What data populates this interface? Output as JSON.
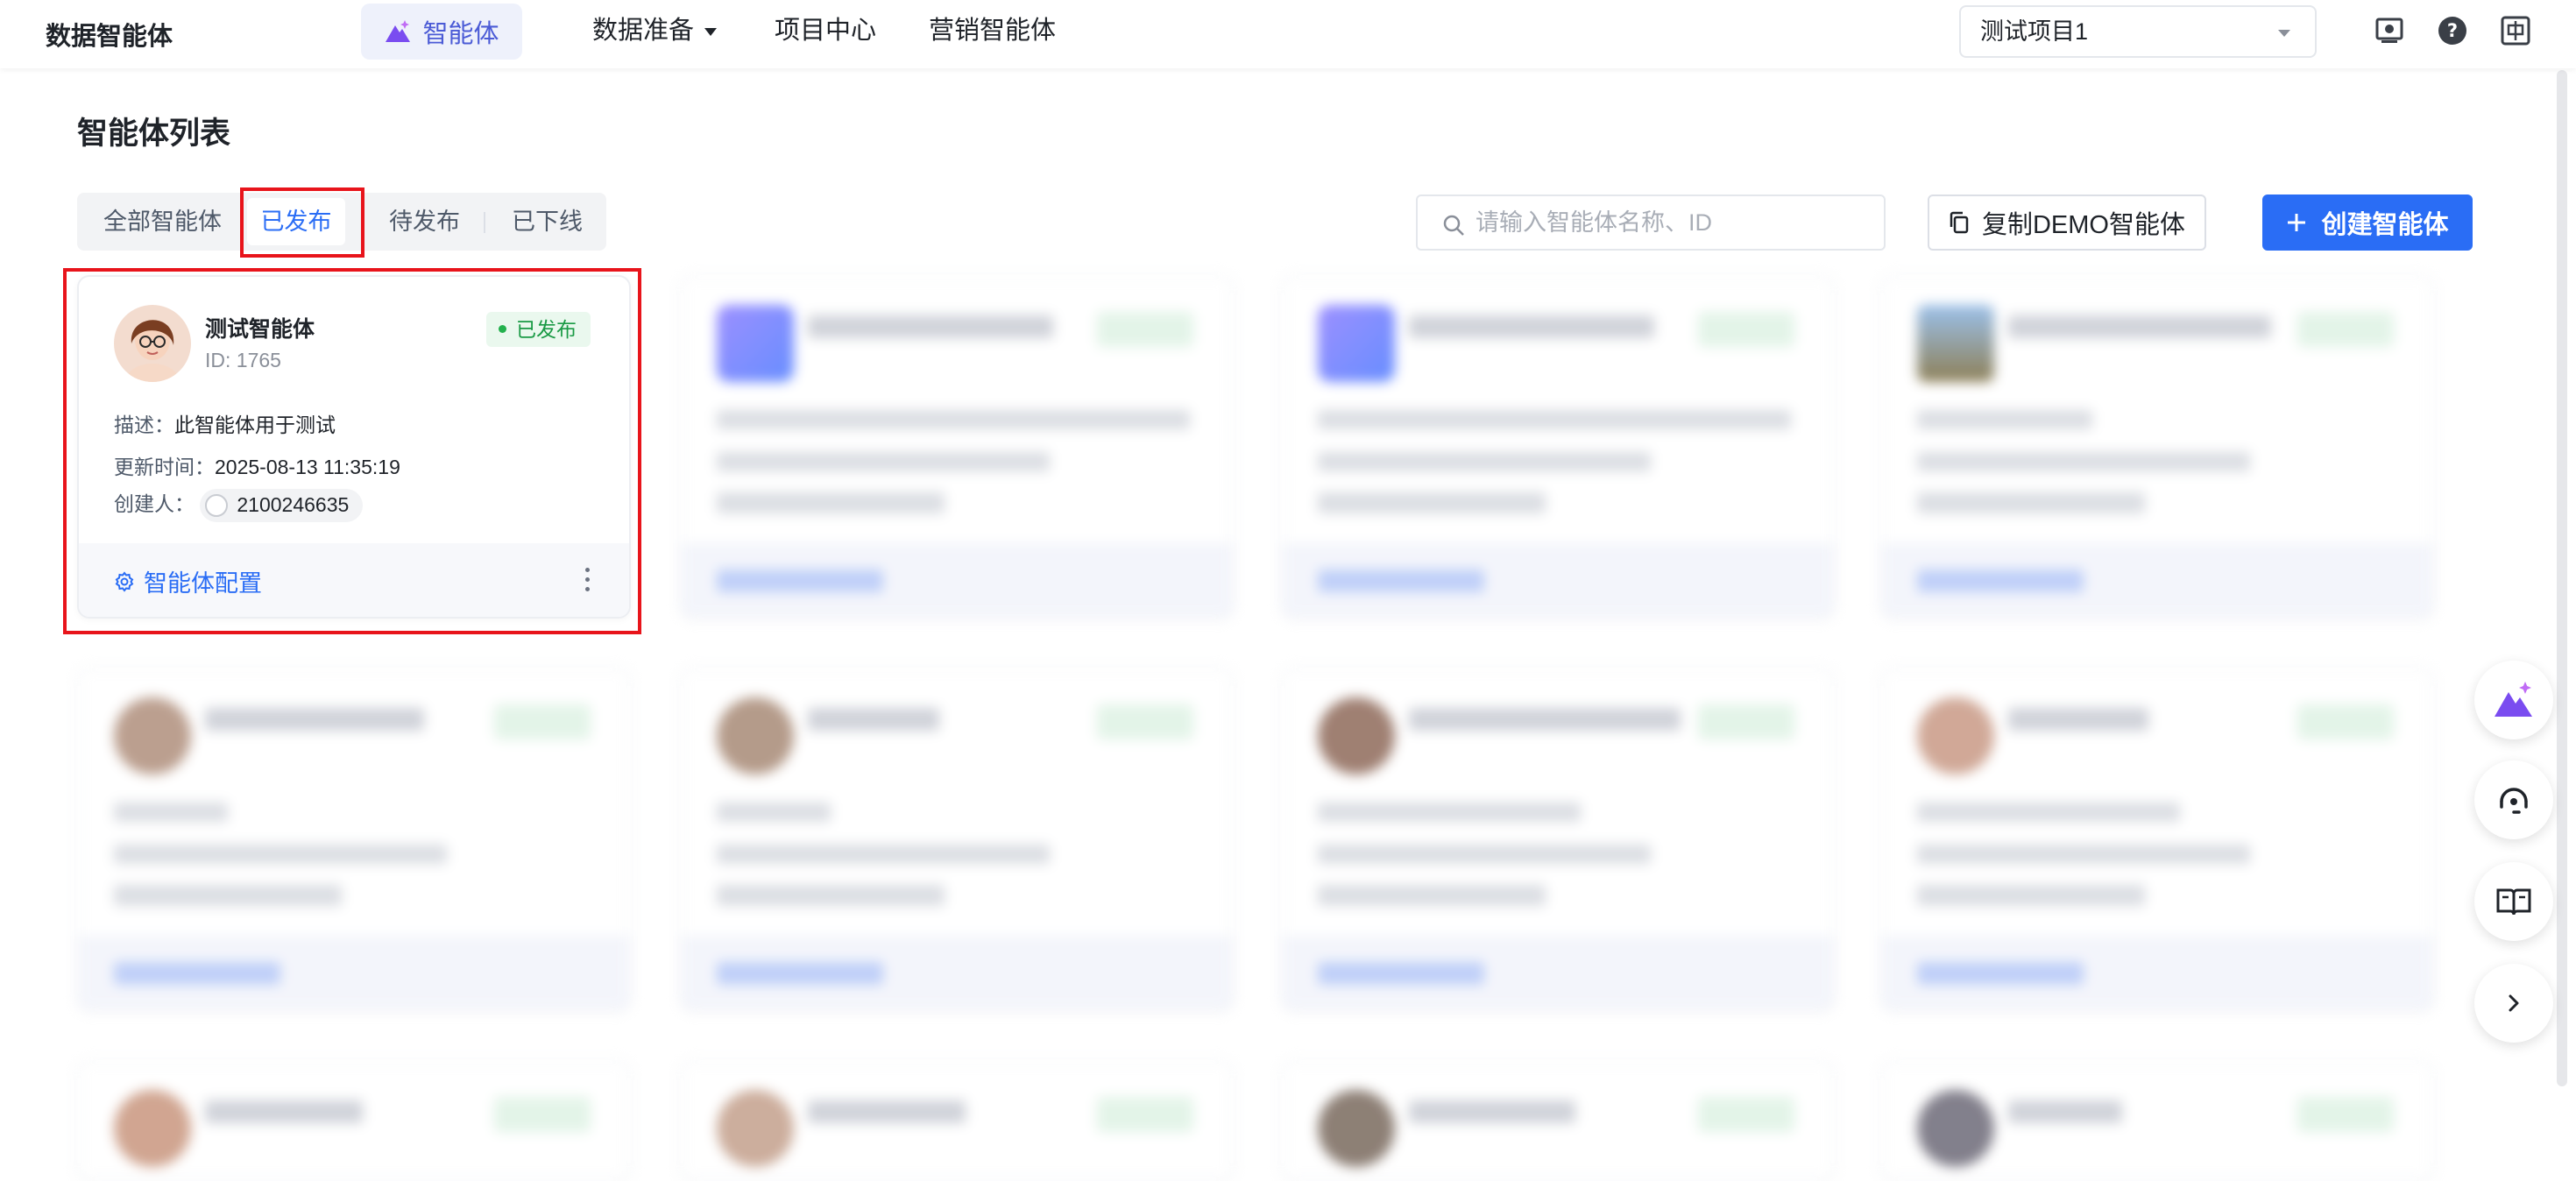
{
  "nav": {
    "brand": "数据智能体",
    "active": "智能体",
    "items": [
      "数据准备",
      "项目中心",
      "营销智能体"
    ],
    "project_select": "测试项目1"
  },
  "page": {
    "title": "智能体列表",
    "tabs": [
      "全部智能体",
      "已发布",
      "待发布",
      "已下线"
    ],
    "active_tab": "已发布",
    "search_placeholder": "请输入智能体名称、ID",
    "copy_button": "复制DEMO智能体",
    "create_button": "创建智能体"
  },
  "featured_card": {
    "name": "测试智能体",
    "id": "ID: 1765",
    "status": "已发布",
    "desc_label": "描述：",
    "desc_value": "此智能体用于测试",
    "updated_label": "更新时间：",
    "updated_value": "2025-08-13 11:35:19",
    "creator_label": "创建人：",
    "creator_value": "2100246635",
    "config_label": "智能体配置"
  },
  "colors": {
    "accent": "#2a6df5",
    "status_green": "#1a9a45",
    "highlight_red": "#e8141b",
    "brand_purple": "#7a4cf0"
  },
  "icons": {
    "nav_logo": "sparkle-mountain-icon",
    "top_right": [
      "screen-settings-icon",
      "help-icon",
      "language-zh-icon"
    ],
    "floating": [
      "ai-assistant-icon",
      "headset-icon",
      "book-icon",
      "chevron-right-icon"
    ]
  }
}
